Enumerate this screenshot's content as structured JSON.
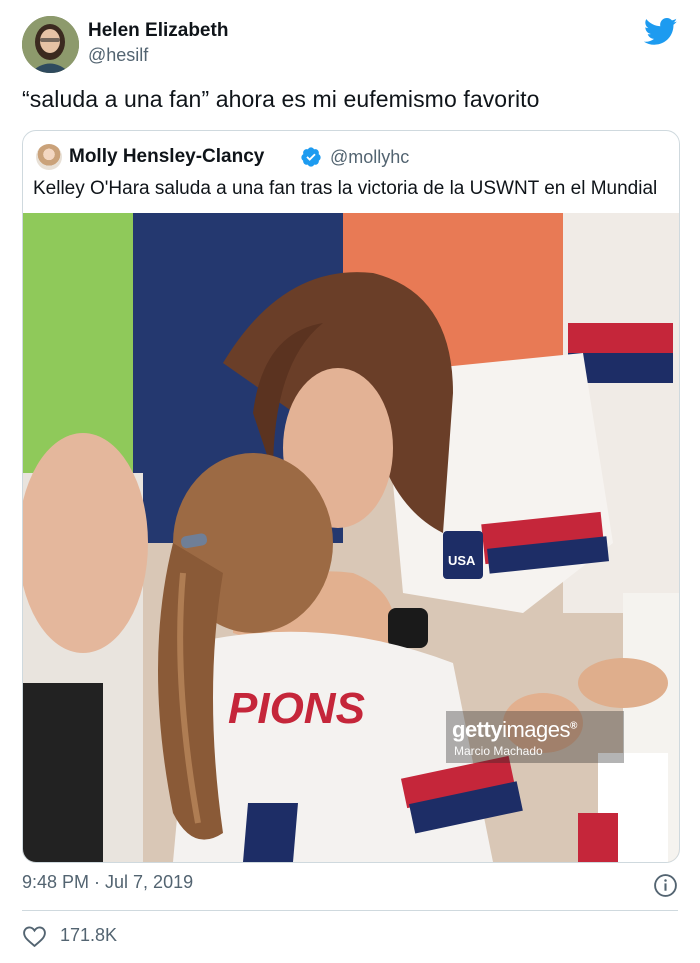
{
  "author": {
    "display_name": "Helen Elizabeth",
    "handle": "@hesilf",
    "avatar_icon": "avatar-photo"
  },
  "brand": {
    "icon": "twitter-bird-icon",
    "color": "#1d9bf0"
  },
  "tweet": {
    "text": "“saluda a una fan” ahora es mi eufemismo favorito"
  },
  "quoted_tweet": {
    "display_name": "Molly Hensley-Clancy",
    "verified": true,
    "handle": "@mollyhc",
    "text": "Kelley O'Hara saluda a una fan tras la victoria de la USWNT en el Mundial",
    "photo": {
      "watermark_brand_bold": "getty",
      "watermark_brand_thin": "images",
      "watermark_mark": "®",
      "watermark_credit": "Marcio Machado",
      "jersey_text": "PIONS",
      "crest_text": "USA"
    }
  },
  "footer": {
    "timestamp": "9:48 PM · Jul 7, 2019",
    "likes": "171.8K"
  },
  "colors": {
    "text_primary": "#0f1419",
    "text_secondary": "#536471",
    "border": "#cfd9de",
    "verified_blue": "#1d9bf0"
  }
}
